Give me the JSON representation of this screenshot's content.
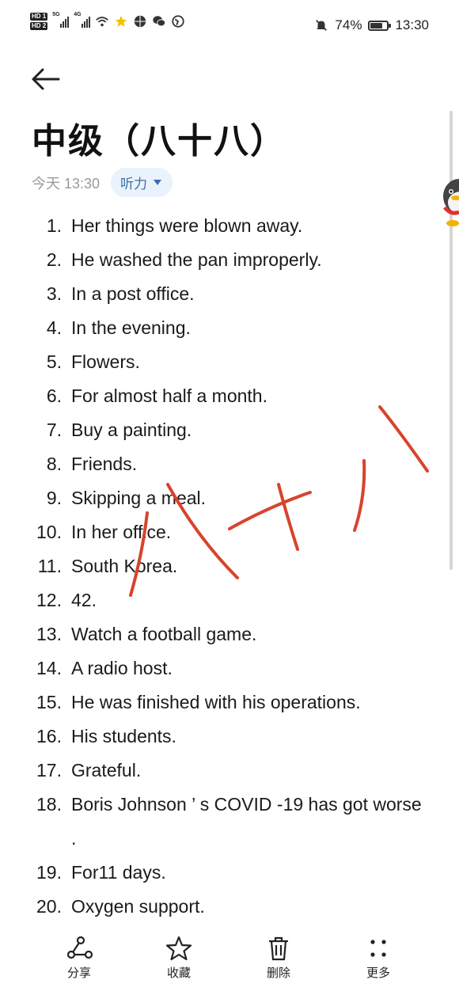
{
  "status_bar": {
    "sim1": "HD 1",
    "sim2": "HD 2",
    "network1": "5G",
    "network2": "4G",
    "battery_text": "74%",
    "battery_level": 0.74,
    "time": "13:30"
  },
  "note": {
    "title": "中级（八十八）",
    "date": "今天 13:30",
    "category": "听力"
  },
  "answers": [
    {
      "num": "1.",
      "text": "Her things were blown away."
    },
    {
      "num": "2.",
      "text": "He washed the pan improperly."
    },
    {
      "num": "3.",
      "text": "In a post office."
    },
    {
      "num": "4.",
      "text": "In the evening."
    },
    {
      "num": "5.",
      "text": "Flowers."
    },
    {
      "num": "6.",
      "text": "For almost half a month."
    },
    {
      "num": "7.",
      "text": "Buy a painting."
    },
    {
      "num": "8.",
      "text": "Friends."
    },
    {
      "num": "9.",
      "text": "Skipping a meal."
    },
    {
      "num": "10.",
      "text": "In her office."
    },
    {
      "num": "11.",
      "text": "South Korea."
    },
    {
      "num": "12.",
      "text": "42."
    },
    {
      "num": "13.",
      "text": "Watch a football game."
    },
    {
      "num": "14.",
      "text": "A radio host."
    },
    {
      "num": "15.",
      "text": "He was finished with his operations."
    },
    {
      "num": "16.",
      "text": "His students."
    },
    {
      "num": "17.",
      "text": "Grateful."
    },
    {
      "num": "18.",
      "text": "Boris Johnson ’ s COVID -19 has got worse ."
    },
    {
      "num": "19.",
      "text": "For11 days."
    },
    {
      "num": "20.",
      "text": "Oxygen support."
    }
  ],
  "toolbar": {
    "share": "分享",
    "favorite": "收藏",
    "delete": "删除",
    "more": "更多"
  },
  "colors": {
    "accent_chip_bg": "#eaf2fb",
    "accent_chip_text": "#3d6fa8",
    "handwriting": "#d8432c"
  }
}
